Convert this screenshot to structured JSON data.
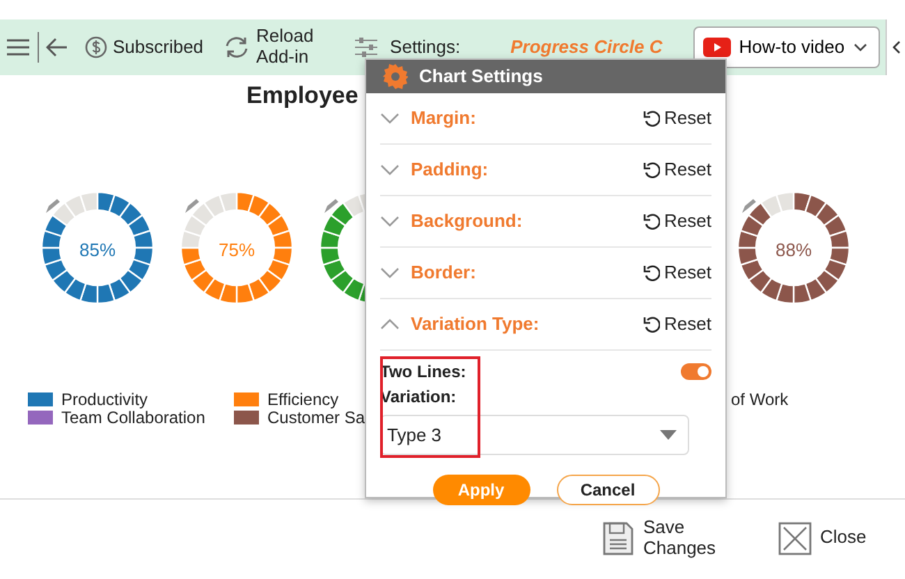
{
  "toolbar": {
    "subscribed": "Subscribed",
    "reload": "Reload Add-in",
    "settings": "Settings:",
    "chart_name": "Progress Circle C",
    "video_button": "How-to video"
  },
  "chart": {
    "title": "Employee",
    "donuts": [
      {
        "label": "85%",
        "level": 0.85,
        "color": "#1f77b4"
      },
      {
        "label": "75%",
        "level": 0.75,
        "color": "#ff7f0e"
      },
      {
        "level": 0.9,
        "color": "#2ca02c"
      },
      {
        "label": "88%",
        "level": 0.88,
        "color": "#8c564b"
      }
    ],
    "legend": [
      {
        "label": "Productivity",
        "color": "#1f77b4"
      },
      {
        "label": "Team Collaboration",
        "color": "#9467bd"
      },
      {
        "label": "Efficiency",
        "color": "#ff7f0e"
      },
      {
        "label": "Customer Sa",
        "color": "#8c564b"
      },
      {
        "label": "of Work"
      }
    ]
  },
  "dialog": {
    "title": "Chart Settings",
    "sections": [
      {
        "label": "Margin:",
        "expanded": false,
        "reset": "Reset"
      },
      {
        "label": "Padding:",
        "expanded": false,
        "reset": "Reset"
      },
      {
        "label": "Background:",
        "expanded": false,
        "reset": "Reset"
      },
      {
        "label": "Border:",
        "expanded": false,
        "reset": "Reset"
      },
      {
        "label": "Variation Type:",
        "expanded": true,
        "reset": "Reset"
      }
    ],
    "two_lines": {
      "label": "Two Lines:",
      "on": true
    },
    "variation": {
      "label": "Variation:",
      "value": "Type 3",
      "highlighted": true
    },
    "apply": "Apply",
    "cancel": "Cancel"
  },
  "footer": {
    "save": "Save Changes",
    "close": "Close"
  }
}
